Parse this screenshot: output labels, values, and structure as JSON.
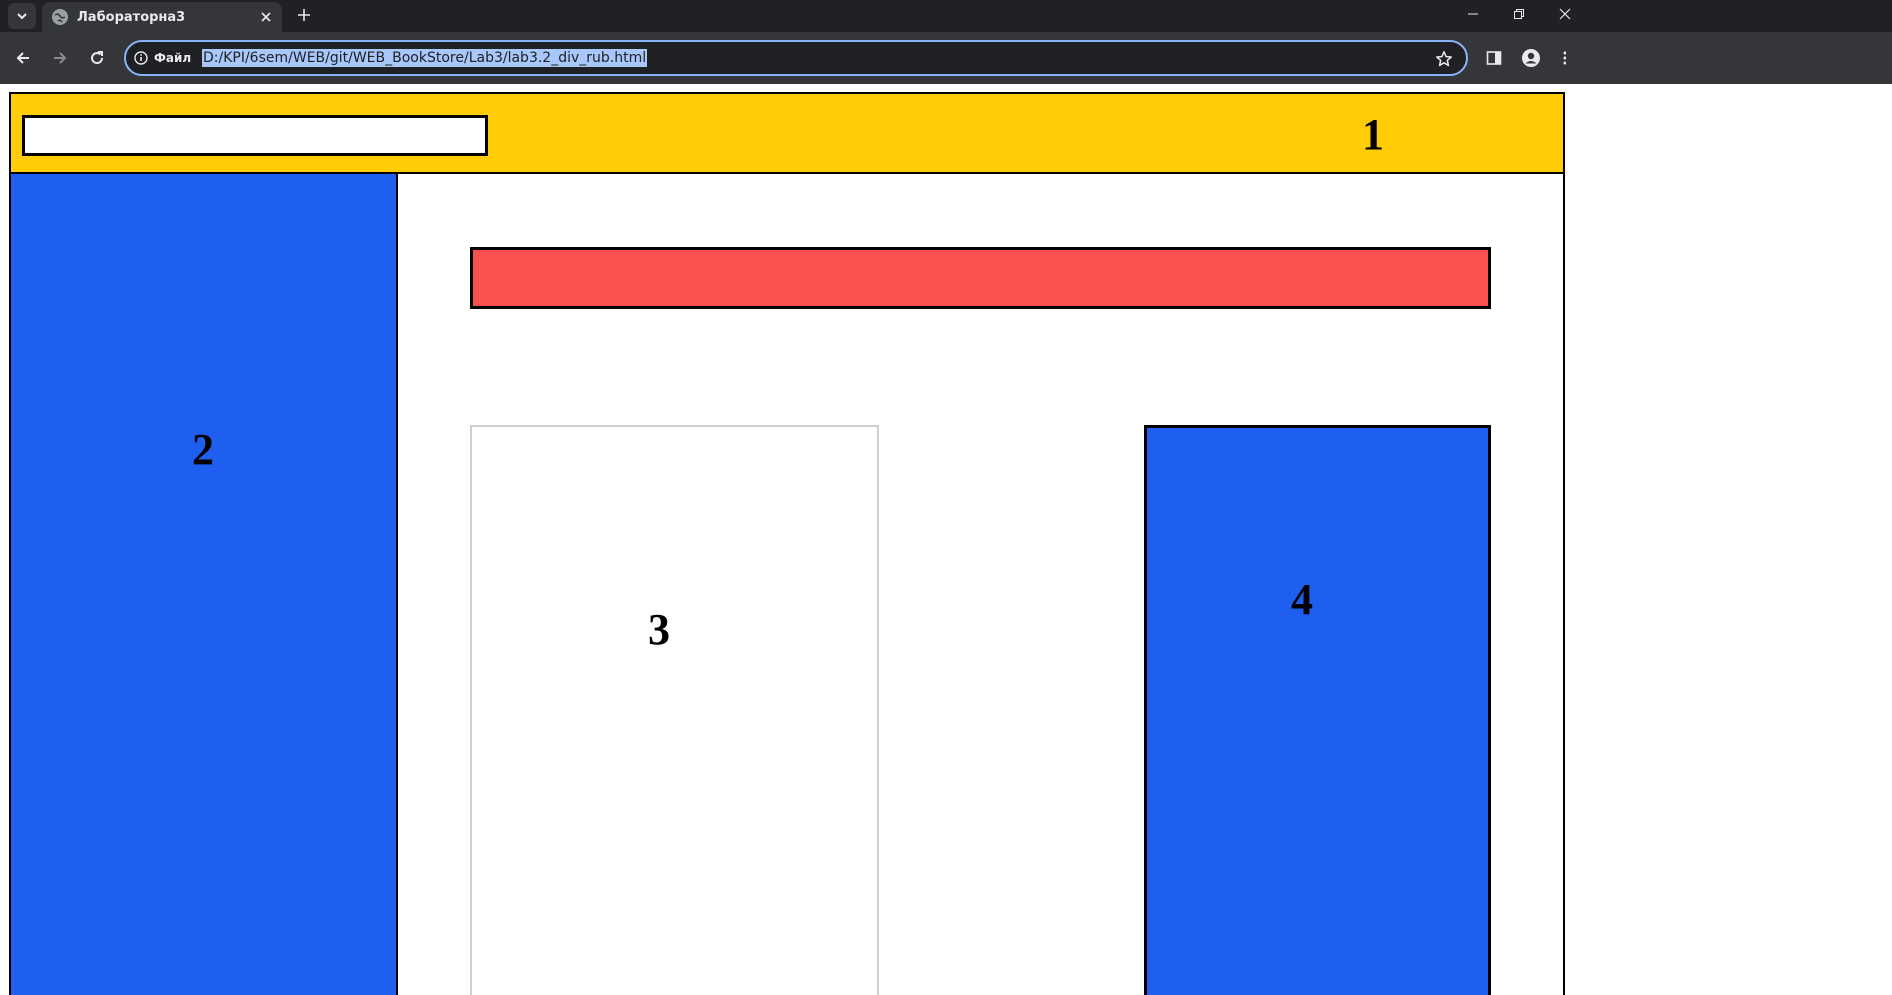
{
  "browser": {
    "tab": {
      "title": "Лабораторна3",
      "close_icon": "close-icon",
      "favicon": "globe-icon"
    },
    "new_tab_icon": "plus-icon",
    "tab_menu_icon": "chevron-down-icon",
    "window_controls": [
      "minimize-icon",
      "restore-icon",
      "close-icon"
    ],
    "address_bar": {
      "site_info_label": "Файл",
      "url": "D:/KPI/6sem/WEB/git/WEB_BookStore/Lab3/lab3.2_div_rub.html",
      "selected": true
    }
  },
  "page": {
    "header": {
      "label": "1",
      "input_value": "",
      "color": "#ffcc05"
    },
    "sidebar": {
      "label": "2",
      "color": "#1f5ff0"
    },
    "banner": {
      "color": "#fa5050"
    },
    "block_three": {
      "label": "3"
    },
    "block_four": {
      "label": "4",
      "color": "#1f5ff0"
    }
  }
}
